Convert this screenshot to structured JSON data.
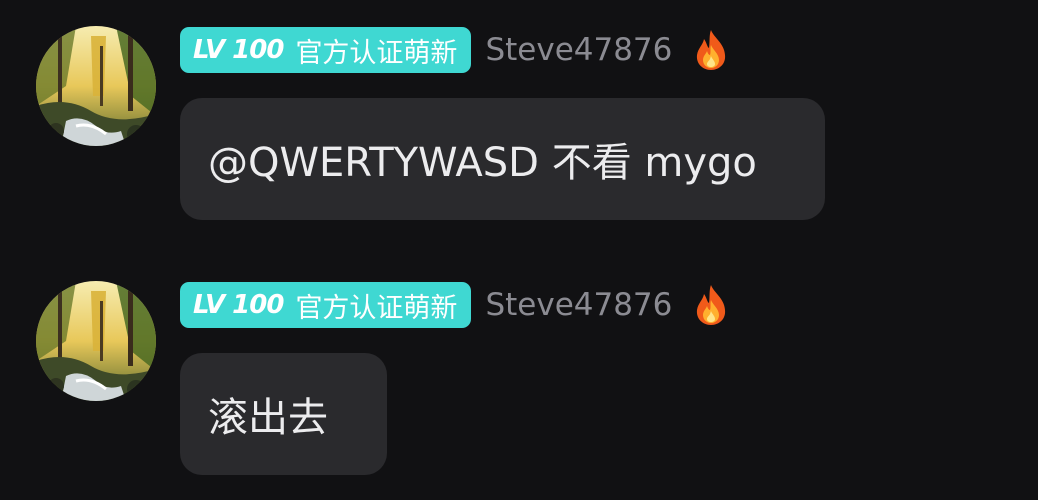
{
  "messages": [
    {
      "badge": {
        "level": "LV 100",
        "title": "官方认证萌新"
      },
      "username": "Steve47876",
      "status_icon": "fire-icon",
      "text": "@QWERTYWASD 不看 mygo"
    },
    {
      "badge": {
        "level": "LV 100",
        "title": "官方认证萌新"
      },
      "username": "Steve47876",
      "status_icon": "fire-icon",
      "text": "滚出去"
    }
  ],
  "colors": {
    "background": "#111113",
    "badge": "#3fd8d2",
    "bubble": "#2a2a2d",
    "username": "#8b8b92",
    "message_text": "#ececee"
  }
}
